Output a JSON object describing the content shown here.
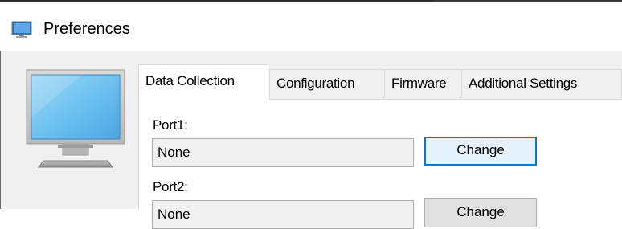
{
  "window": {
    "title": "Preferences",
    "title_icon": "monitor-icon"
  },
  "sidebar": {
    "image": "monitor-illustration"
  },
  "tabs": [
    {
      "label": "Data Collection",
      "active": true
    },
    {
      "label": "Configuration",
      "active": false
    },
    {
      "label": "Firmware",
      "active": false
    },
    {
      "label": "Additional Settings",
      "active": false
    }
  ],
  "ports": [
    {
      "label": "Port1:",
      "value": "None",
      "button_label": "Change"
    },
    {
      "label": "Port2:",
      "value": "None",
      "button_label": "Change"
    }
  ],
  "colors": {
    "accent": "#0078d7",
    "button_bg": "#e1e1e1",
    "focused_button_bg": "#e5f1fb",
    "field_bg": "#f0f0f0"
  }
}
